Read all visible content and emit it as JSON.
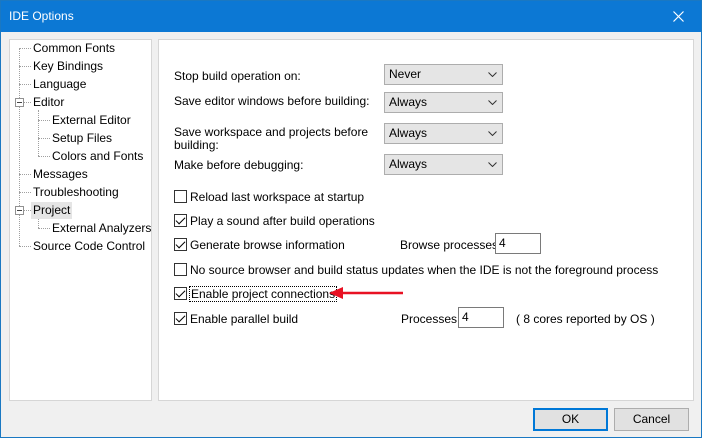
{
  "window": {
    "title": "IDE Options"
  },
  "tree": {
    "items": [
      {
        "label": "Common Fonts"
      },
      {
        "label": "Key Bindings"
      },
      {
        "label": "Language"
      },
      {
        "label": "Editor"
      },
      {
        "label": "External Editor"
      },
      {
        "label": "Setup Files"
      },
      {
        "label": "Colors and Fonts"
      },
      {
        "label": "Messages"
      },
      {
        "label": "Troubleshooting"
      },
      {
        "label": "Project",
        "selected": true
      },
      {
        "label": "External Analyzers"
      },
      {
        "label": "Source Code Control"
      }
    ]
  },
  "project": {
    "stop_build": {
      "label": "Stop build operation on:",
      "value": "Never"
    },
    "save_editor": {
      "label": "Save editor windows before building:",
      "value": "Always"
    },
    "save_workspace": {
      "label_line1": "Save workspace and projects before",
      "label_line2": "building:",
      "value": "Always"
    },
    "make_before_debug": {
      "label": "Make before debugging:",
      "value": "Always"
    },
    "reload_workspace": {
      "label": "Reload last workspace at startup",
      "checked": false
    },
    "play_sound": {
      "label": "Play a sound after build operations",
      "checked": true
    },
    "generate_browse": {
      "label": "Generate browse information",
      "checked": true
    },
    "browse_processes": {
      "label": "Browse processes:",
      "value": "4"
    },
    "no_source_browser": {
      "label": "No source browser and build status updates when the IDE is not the foreground process",
      "checked": false
    },
    "enable_project_connections": {
      "label": "Enable project connections",
      "checked": true
    },
    "enable_parallel_build": {
      "label": "Enable parallel build",
      "checked": true
    },
    "processes": {
      "label": "Processes:",
      "value": "4",
      "note": "( 8 cores reported by OS )"
    }
  },
  "buttons": {
    "ok": "OK",
    "cancel": "Cancel"
  },
  "colors": {
    "titlebar": "#0c78d4",
    "arrow": "#e81123"
  }
}
